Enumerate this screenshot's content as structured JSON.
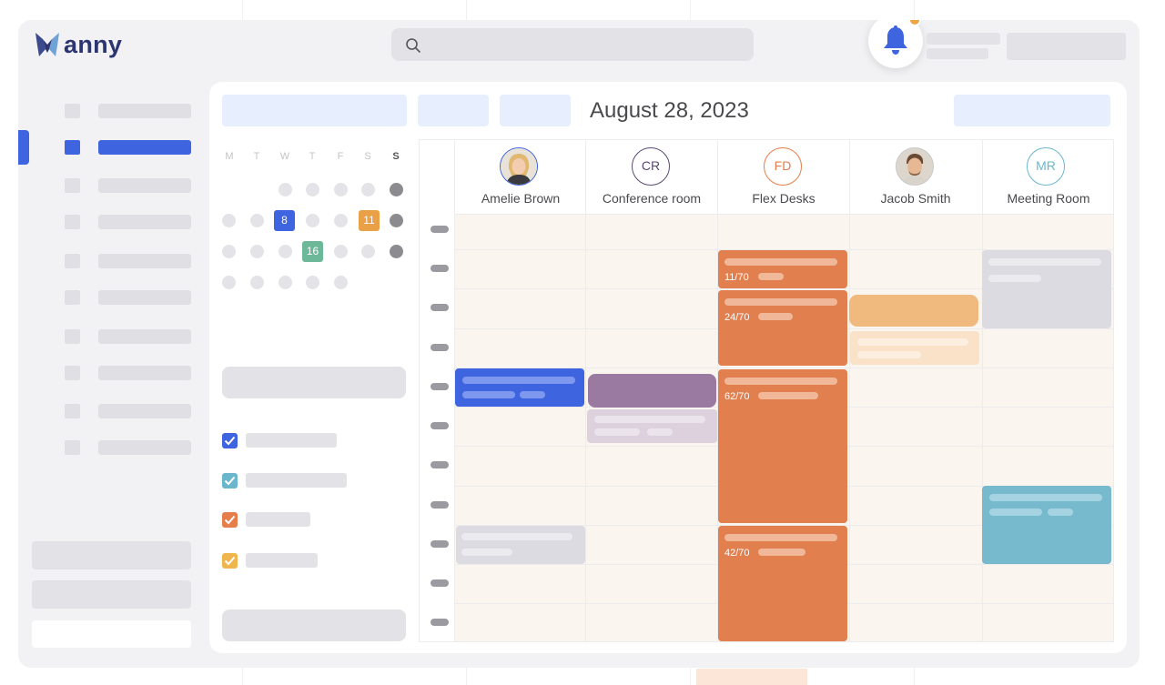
{
  "app": {
    "name": "anny"
  },
  "header": {
    "search": {
      "placeholder": ""
    },
    "notifications": {
      "icon": "bell-icon",
      "has_unread": true,
      "badge_color": "#f0a341"
    }
  },
  "sidebar": {
    "items": [
      {
        "active": false
      },
      {
        "active": true
      },
      {
        "active": false
      },
      {
        "active": false
      },
      {
        "active": false
      },
      {
        "active": false
      },
      {
        "active": false
      },
      {
        "active": false
      },
      {
        "active": false
      },
      {
        "active": false
      }
    ],
    "accent_color": "#3e64e0"
  },
  "calendar": {
    "title": "August 28, 2023",
    "mini_calendar": {
      "weekdays": [
        "M",
        "T",
        "W",
        "T",
        "F",
        "S",
        "S"
      ],
      "highlighted_days": [
        {
          "label": "8",
          "color": "#3e64e0"
        },
        {
          "label": "11",
          "color": "#e9a046"
        },
        {
          "label": "16",
          "color": "#6eb89a"
        }
      ]
    },
    "filters": [
      {
        "checked": true,
        "color": "#3e64e0"
      },
      {
        "checked": true,
        "color": "#6ab7cd"
      },
      {
        "checked": true,
        "color": "#e57e4b"
      },
      {
        "checked": true,
        "color": "#f0b64e"
      }
    ],
    "resources": [
      {
        "name": "Amelie Brown",
        "initials": "",
        "photo": true,
        "ring_color": "#3e64e0"
      },
      {
        "name": "Conference room",
        "initials": "CR",
        "photo": false,
        "ring_color": "#5a4a70"
      },
      {
        "name": "Flex Desks",
        "initials": "FD",
        "photo": false,
        "ring_color": "#e57e4b"
      },
      {
        "name": "Jacob Smith",
        "initials": "",
        "photo": true,
        "ring_color": "#c7c7cc"
      },
      {
        "name": "Meeting Room",
        "initials": "MR",
        "photo": false,
        "ring_color": "#6ab7cd"
      }
    ],
    "events": [
      {
        "label": "11/70"
      },
      {
        "label": "24/70"
      },
      {
        "label": "62/70"
      },
      {
        "label": "42/70"
      }
    ]
  },
  "colors": {
    "blue": "#3e64e0",
    "purple": "#9b7aa2",
    "orange": "#e17f4e",
    "peach": "#f0b97e",
    "teal": "#77b9cd",
    "gray_event": "#dcdbe2"
  }
}
